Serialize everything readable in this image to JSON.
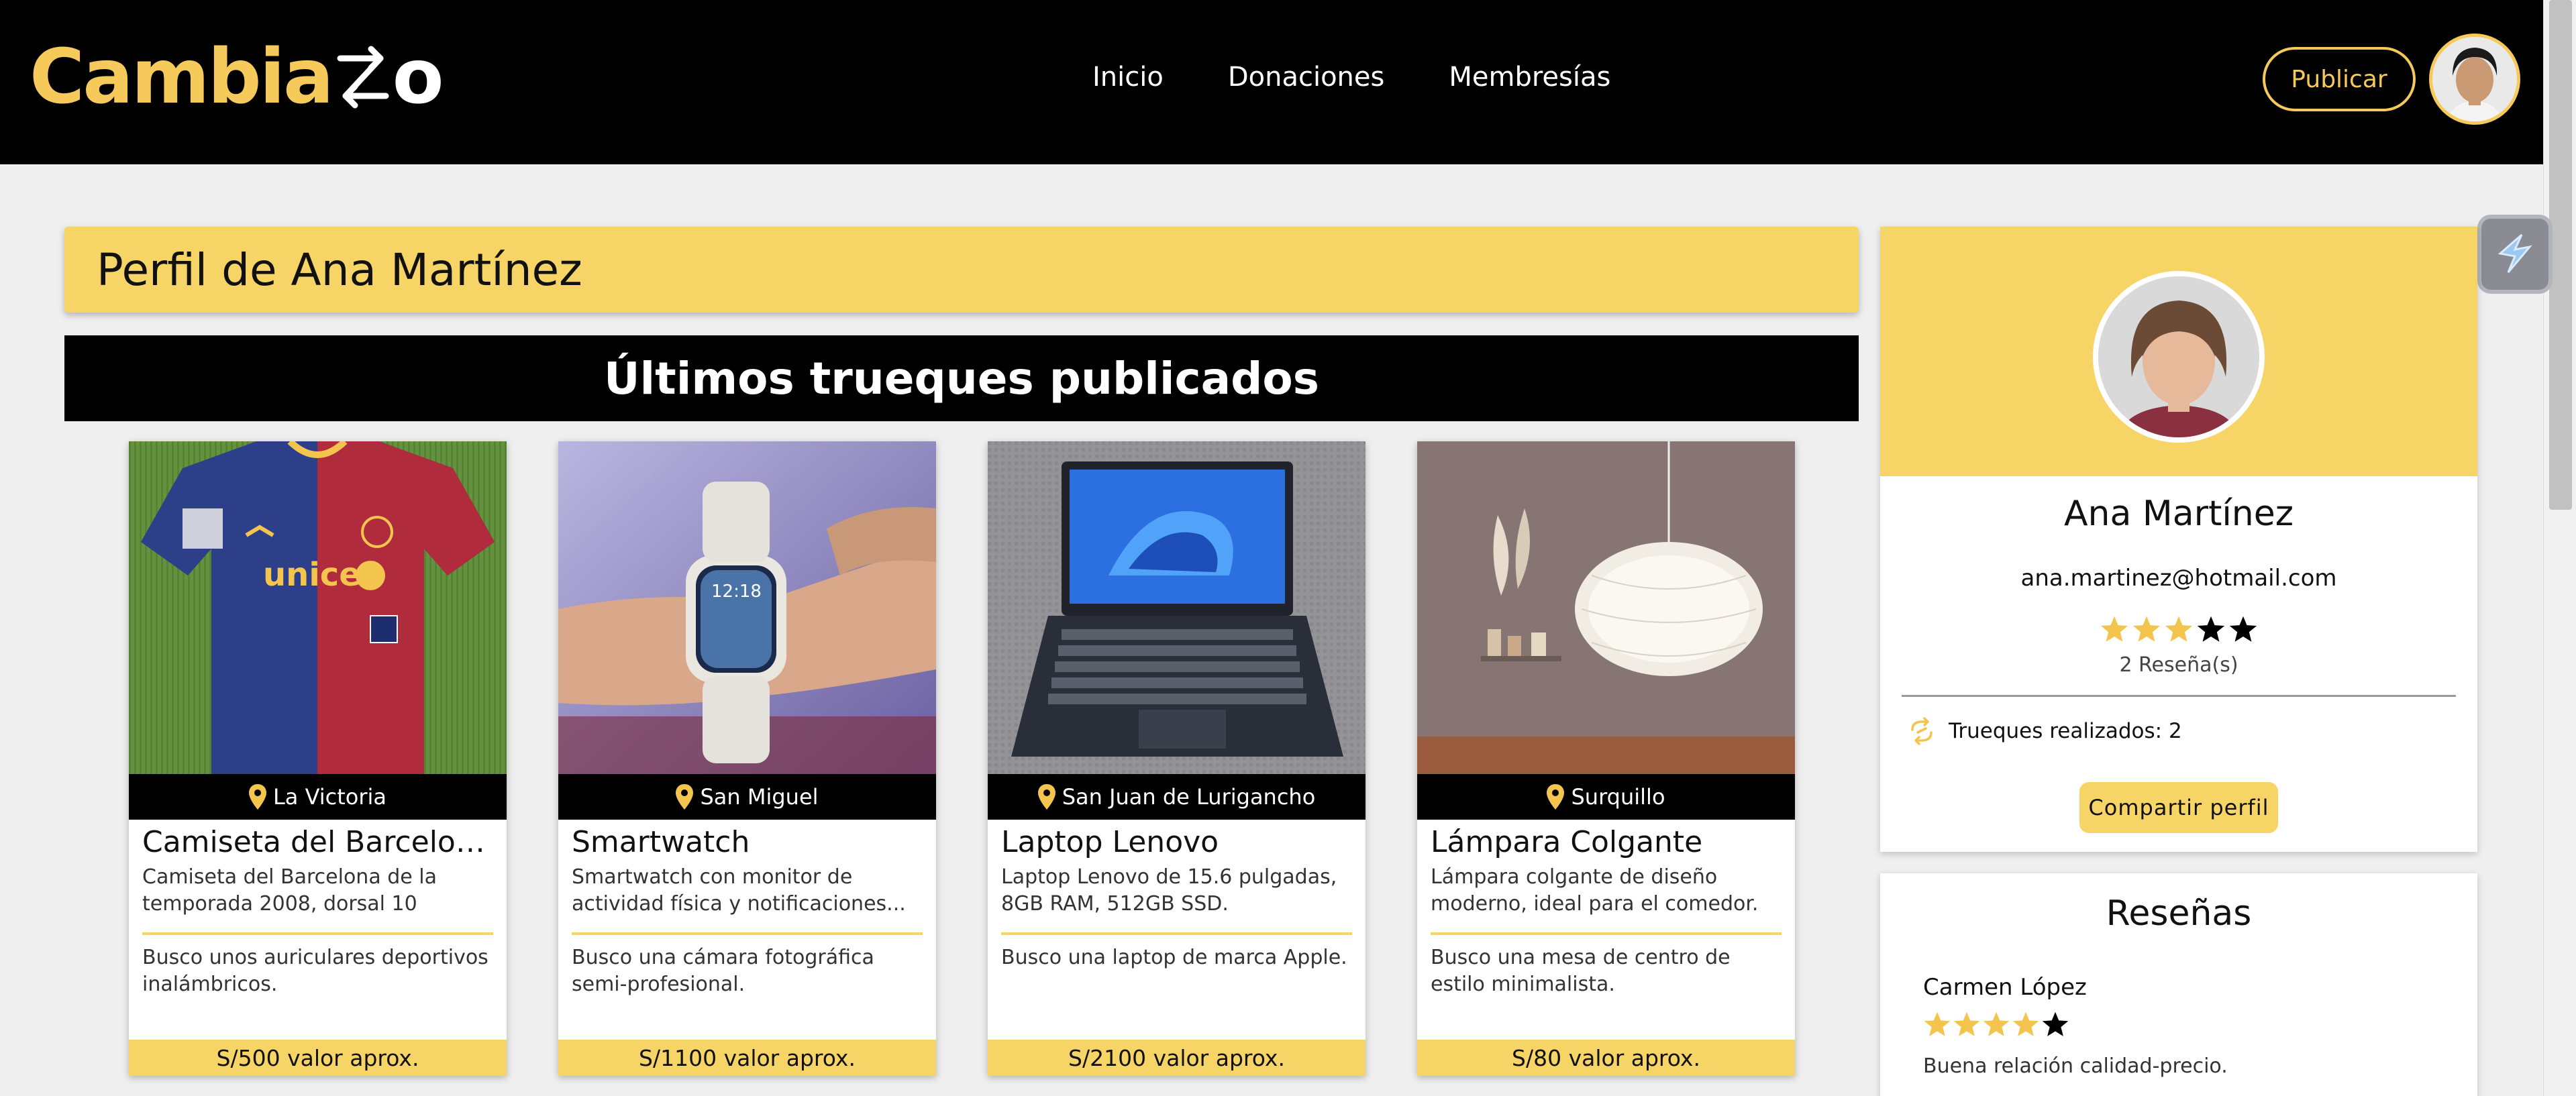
{
  "header": {
    "logo_text": "Cambia",
    "logo_suffix": "o",
    "nav": [
      "Inicio",
      "Donaciones",
      "Membresías"
    ],
    "publish_label": "Publicar"
  },
  "main": {
    "profile_title": "Perfil de Ana Martínez",
    "section_title": "Últimos trueques publicados",
    "cards": [
      {
        "location": "La Victoria",
        "title": "Camiseta del Barcelona...",
        "description": "Camiseta del Barcelona de la temporada 2008, dorsal 10",
        "wish": "Busco unos auriculares deportivos inalámbricos.",
        "price": "S/500 valor aprox.",
        "image": "jersey"
      },
      {
        "location": "San Miguel",
        "title": "Smartwatch",
        "description": "Smartwatch con monitor de actividad física y notificaciones...",
        "wish": "Busco una cámara fotográfica semi-profesional.",
        "price": "S/1100 valor aprox.",
        "image": "watch"
      },
      {
        "location": "San Juan de Lurigancho",
        "title": "Laptop Lenovo",
        "description": "Laptop Lenovo de 15.6 pulgadas, 8GB RAM, 512GB SSD.",
        "wish": "Busco una laptop de marca Apple.",
        "price": "S/2100 valor aprox.",
        "image": "laptop"
      },
      {
        "location": "Surquillo",
        "title": "Lámpara Colgante",
        "description": "Lámpara colgante de diseño moderno, ideal para el comedor.",
        "wish": "Busco una mesa de centro de estilo minimalista.",
        "price": "S/80 valor aprox.",
        "image": "lamp"
      }
    ]
  },
  "profile": {
    "name": "Ana Martínez",
    "email": "ana.martinez@hotmail.com",
    "rating": 3,
    "rating_max": 5,
    "reviews_count": "2 Reseña(s)",
    "trades": "Trueques realizados: 2",
    "share_label": "Compartir perfil"
  },
  "reviews": {
    "title": "Reseñas",
    "items": [
      {
        "author": "Carmen López",
        "rating": 4,
        "text": "Buena relación calidad-precio."
      }
    ]
  },
  "colors": {
    "brand_yellow": "#f6d466",
    "logo_yellow": "#f6c95b",
    "star_filled": "#f3c54f",
    "star_empty": "#000000"
  }
}
